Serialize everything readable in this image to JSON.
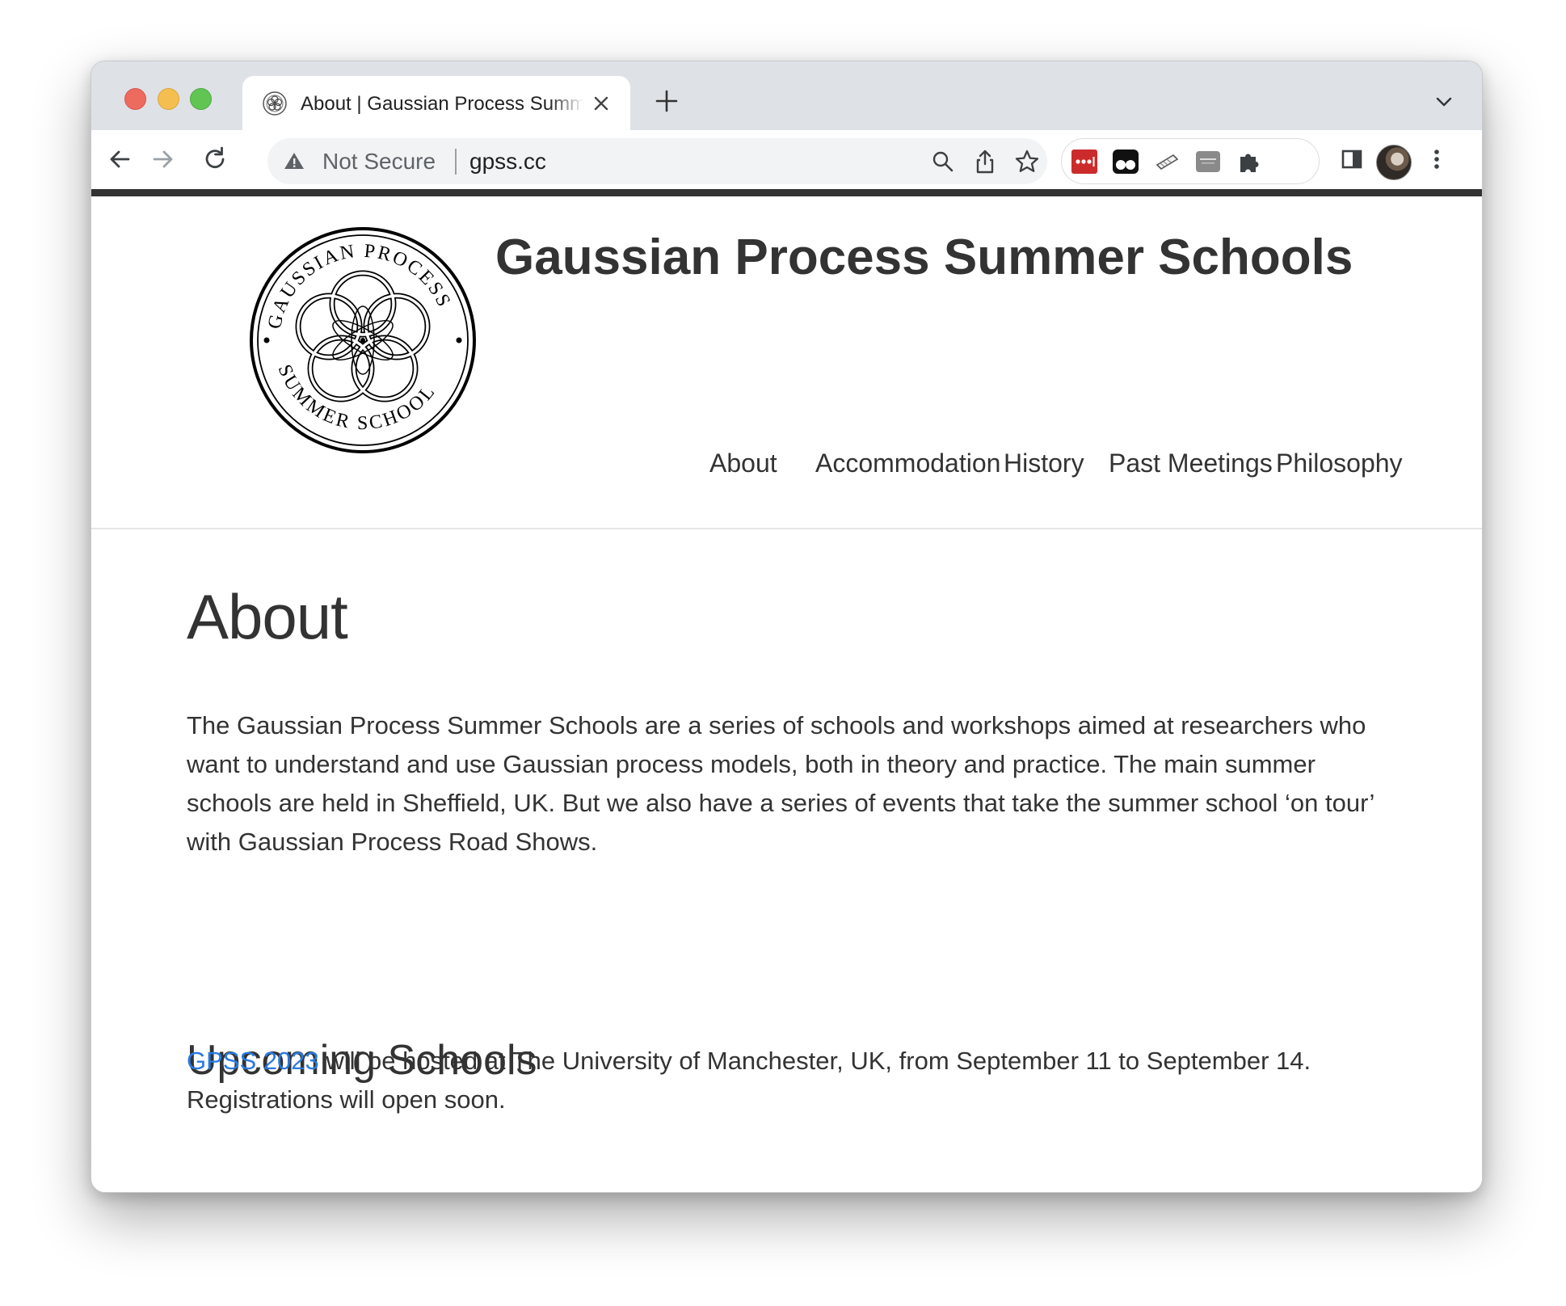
{
  "browser": {
    "tab": {
      "title": "About | Gaussian Process Summer Schools"
    },
    "omnibox": {
      "security_label": "Not Secure",
      "url": "gpss.cc"
    },
    "icons": {
      "back": "back-arrow-icon",
      "forward": "forward-arrow-icon",
      "reload": "reload-icon",
      "search": "search-icon",
      "share": "share-icon",
      "bookmark": "bookmark-star-icon",
      "extensions": [
        "lastpass-extension-icon",
        "tampermonkey-extension-icon",
        "edit-extension-icon",
        "gray-extension-icon",
        "puzzle-extensions-icon"
      ],
      "side_panel": "side-panel-icon",
      "profile": "avatar",
      "menu": "kebab-menu-icon"
    }
  },
  "site": {
    "title": "Gaussian Process Summer Schools",
    "logo_text": "GAUSSIAN PROCESS SUMMER SCHOOL",
    "nav": [
      "About",
      "Accommodation",
      "History",
      "Past Meetings",
      "Philosophy"
    ]
  },
  "content": {
    "heading": "About",
    "intro": "The Gaussian Process Summer Schools are a series of schools and workshops aimed at researchers who want to understand and use Gaussian process models, both in theory and practice. The main summer schools are held in Sheffield, UK. But we also have a series of events that take the summer school ‘on tour’ with Gaussian Process Road Shows.",
    "upcoming_heading": "Upcoming Schools",
    "upcoming_link": "GPSS 2023",
    "upcoming_text": " will be hosted at The University of Manchester, UK, from September 11 to September 14. Registrations will open soon."
  },
  "colors": {
    "link": "#2a7ae2",
    "text": "#333333",
    "header_bar": "#333333"
  }
}
